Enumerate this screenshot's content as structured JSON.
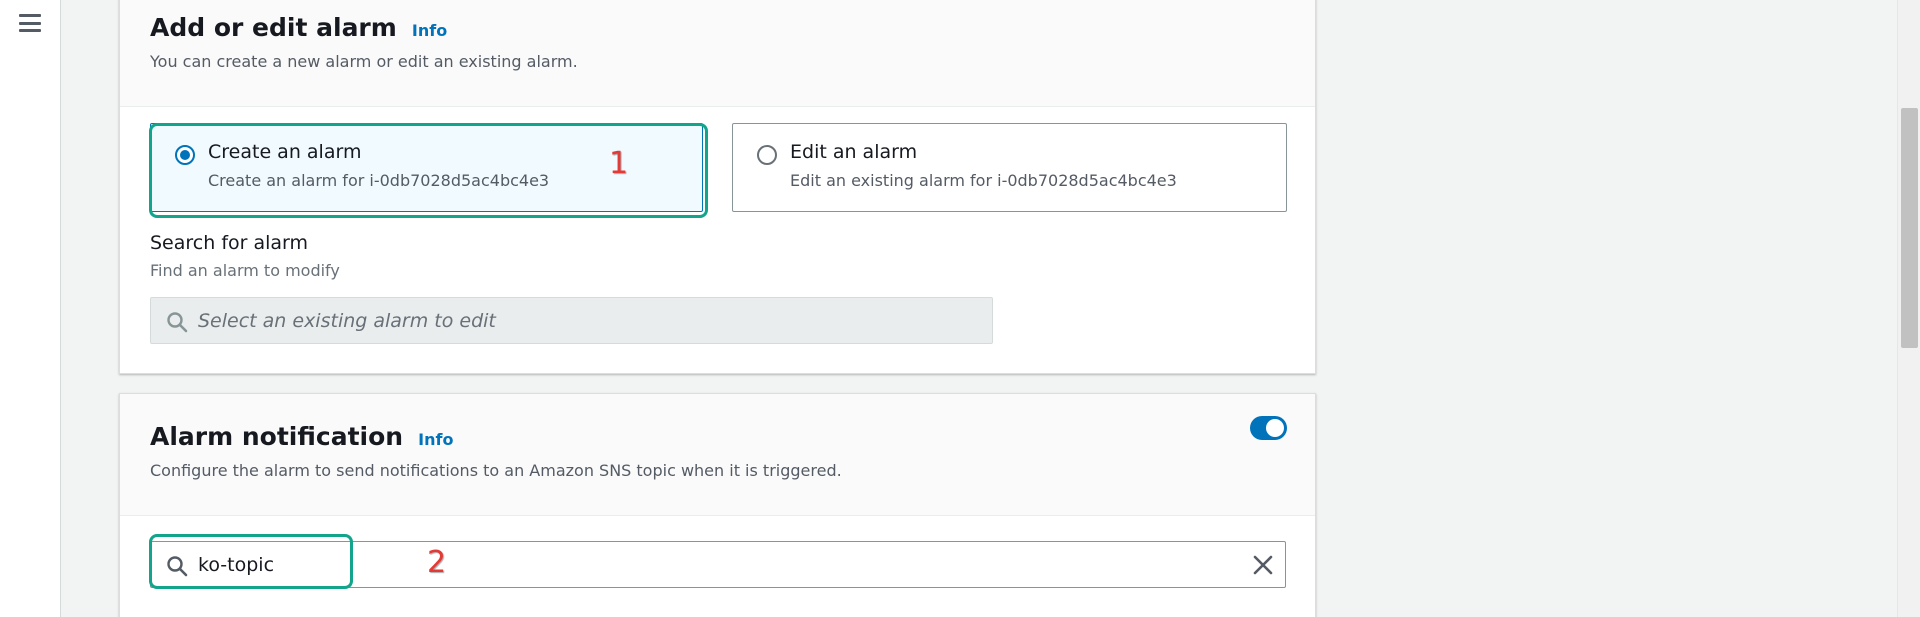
{
  "nav": {
    "menu_icon": "hamburger-menu-icon"
  },
  "alarm_panel": {
    "title": "Add or edit alarm",
    "info": "Info",
    "description": "You can create a new alarm or edit an existing alarm.",
    "options": [
      {
        "label": "Create an alarm",
        "description": "Create an alarm for i-0db7028d5ac4bc4e3",
        "selected": true
      },
      {
        "label": "Edit an alarm",
        "description": "Edit an existing alarm for i-0db7028d5ac4bc4e3",
        "selected": false
      }
    ],
    "search": {
      "label": "Search for alarm",
      "description": "Find an alarm to modify",
      "placeholder": "Select an existing alarm to edit",
      "icon": "search-icon"
    }
  },
  "notification_panel": {
    "title": "Alarm notification",
    "info": "Info",
    "description": "Configure the alarm to send notifications to an Amazon SNS topic when it is triggered.",
    "toggle_on": true,
    "topic_input": {
      "value": "ko-topic",
      "icon": "search-icon",
      "clear_icon": "close-icon"
    }
  },
  "annotations": [
    "1",
    "2"
  ],
  "colors": {
    "accent": "#0073bb",
    "annotation_box": "#12a58c",
    "annotation_number": "#e53935"
  }
}
